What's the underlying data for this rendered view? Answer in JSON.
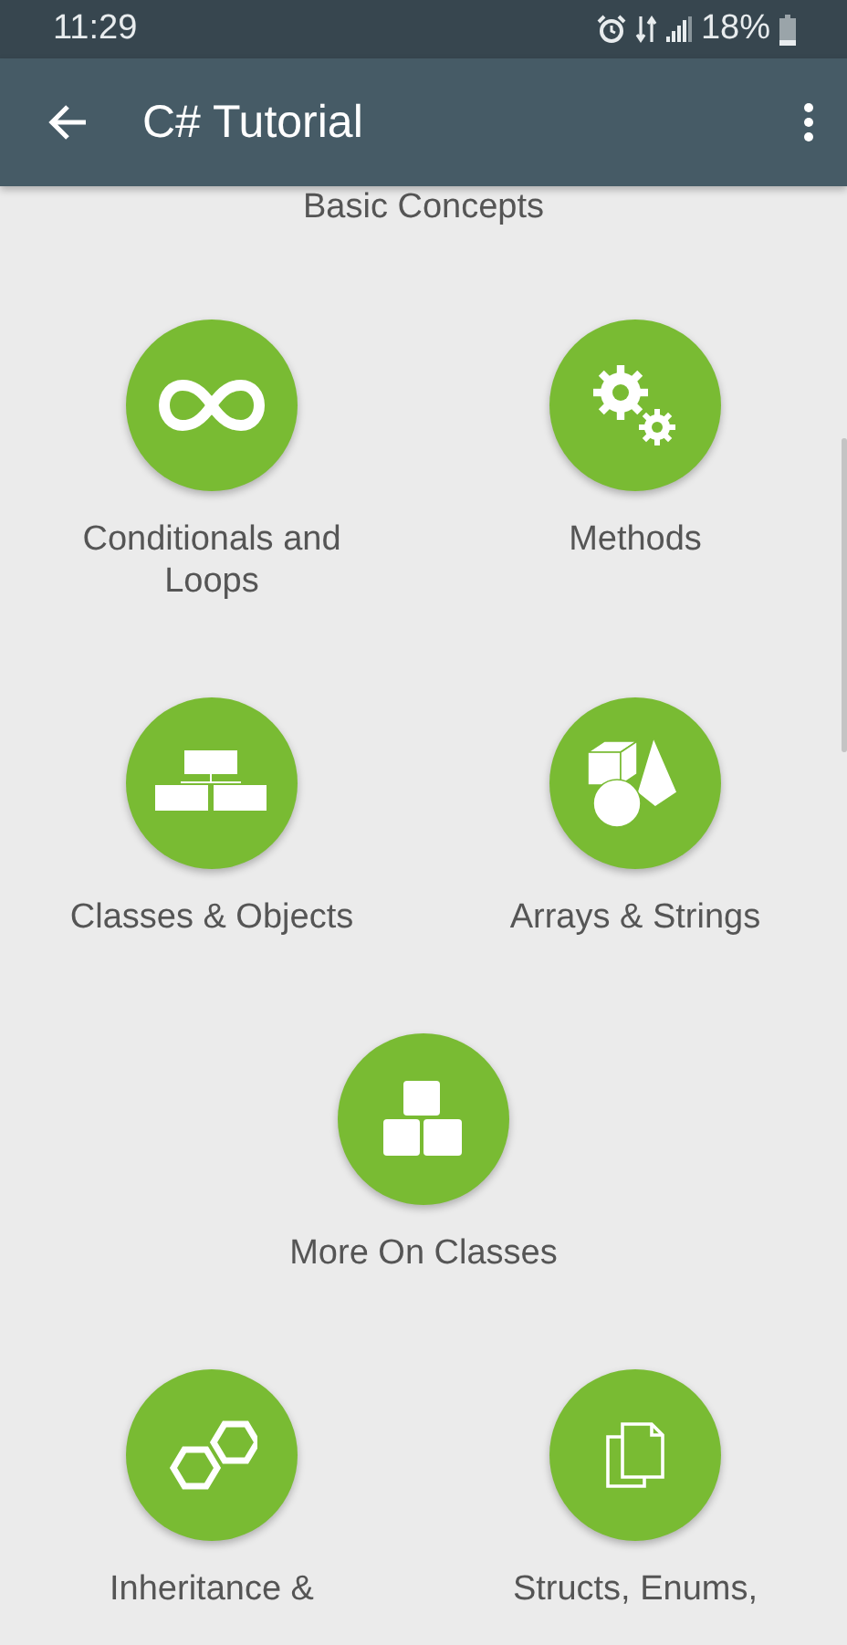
{
  "status_bar": {
    "time": "11:29",
    "battery": "18%"
  },
  "app_bar": {
    "title": "C# Tutorial"
  },
  "section_title": "Basic Concepts",
  "rows": [
    {
      "items": [
        {
          "label": "Conditionals and Loops"
        },
        {
          "label": "Methods"
        }
      ]
    },
    {
      "items": [
        {
          "label": "Classes & Objects"
        },
        {
          "label": "Arrays & Strings"
        }
      ]
    },
    {
      "items": [
        {
          "label": "More On Classes"
        }
      ]
    },
    {
      "items": [
        {
          "label": "Inheritance &"
        },
        {
          "label": "Structs, Enums,"
        }
      ]
    }
  ]
}
